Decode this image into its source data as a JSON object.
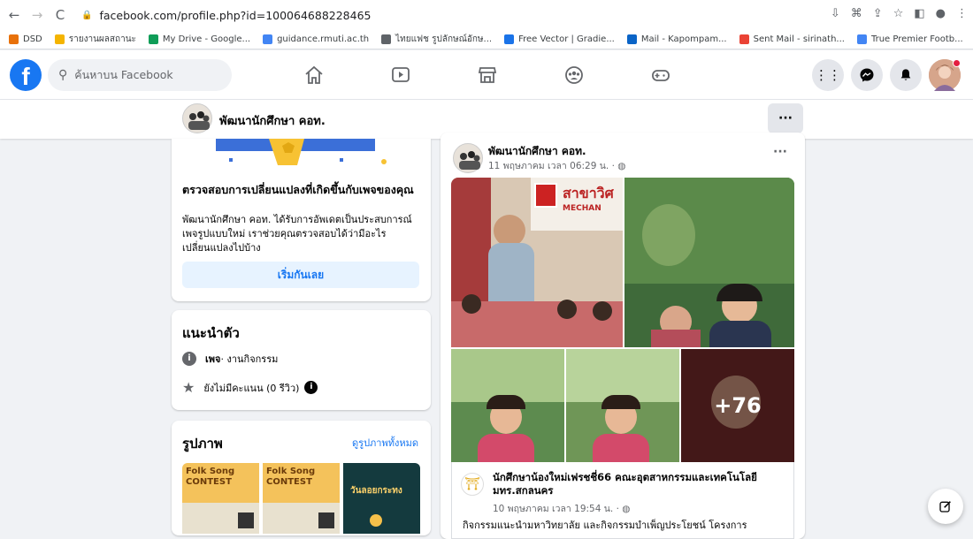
{
  "browser": {
    "url": "facebook.com/profile.php?id=100064688228465",
    "bookmarks": [
      {
        "label": "DSD",
        "icon": "dsd-icon",
        "color": "#e8710a"
      },
      {
        "label": "รายงานผลสถานะ",
        "icon": "report-icon",
        "color": "#f4b400"
      },
      {
        "label": "My Drive - Google...",
        "icon": "google-drive-icon",
        "color": "#0f9d58"
      },
      {
        "label": "guidance.rmuti.ac.th",
        "icon": "guidance-icon",
        "color": "#4285f4"
      },
      {
        "label": "ไทยแฟช รูปลักษณ์อักษ...",
        "icon": "page-icon",
        "color": "#5f6368"
      },
      {
        "label": "Free Vector | Gradie...",
        "icon": "freepik-icon",
        "color": "#1a73e8"
      },
      {
        "label": "Mail - Kapompam...",
        "icon": "outlook-icon",
        "color": "#0a64c7"
      },
      {
        "label": "Sent Mail - sirinath...",
        "icon": "gmail-icon",
        "color": "#ea4335"
      },
      {
        "label": "True Premier Footb...",
        "icon": "google-icon",
        "color": "#4285f4"
      }
    ]
  },
  "fb": {
    "search_placeholder": "ค้นหาบน Facebook",
    "page_name": "พัฒนานักศึกษา คอท."
  },
  "left": {
    "changes_title": "ตรวจสอบการเปลี่ยนแปลงที่เกิดขึ้นกับเพจของคุณ",
    "changes_body": "พัฒนานักศึกษา คอท. ได้รับการอัพเดตเป็นประสบการณ์เพจรูปแบบใหม่ เราช่วยคุณตรวจสอบได้ว่ามีอะไรเปลี่ยนแปลงไปบ้าง",
    "start_button": "เริ่มกันเลย",
    "intro_title": "แนะนำตัว",
    "page_type_label": "เพจ",
    "page_type_value": " · งานกิจกรรม",
    "rating": "ยังไม่มีคะแนน (0 รีวิว)",
    "photos_title": "รูปภาพ",
    "see_all": "ดูรูปภาพทั้งหมด",
    "thumb1_text": "Folk Song CONTEST",
    "thumb2_text": "Folk Song CONTEST",
    "thumb3_text": "วันลอยกระทง"
  },
  "post": {
    "author": "พัฒนานักศึกษา คอท.",
    "time": "11 พฤษภาคม เวลา 06:29 น. · ",
    "banner_text": "สาขาวิศ",
    "banner_sub": "MECHAN",
    "more_count": "+76",
    "shared_title": "นักศึกษาน้องใหม่เฟรชชี่66 คณะอุตสาหกรรมและเทคโนโลยี มทร.สกลนคร",
    "shared_time": "10 พฤษภาคม เวลา 19:54 น. · ",
    "body": "กิจกรรมแนะนำมหาวิทยาลัย และกิจกรรมบำเพ็ญประโยชน์ โครงการ"
  }
}
